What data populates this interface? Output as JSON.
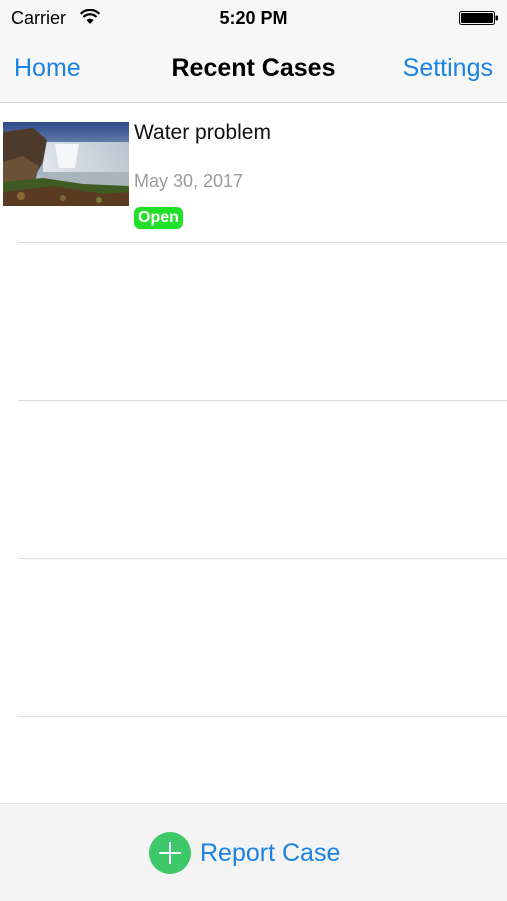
{
  "status_bar": {
    "carrier": "Carrier",
    "time": "5:20 PM",
    "icons": [
      "wifi-icon",
      "battery-icon"
    ]
  },
  "nav": {
    "left_label": "Home",
    "title": "Recent Cases",
    "right_label": "Settings"
  },
  "cases": [
    {
      "title": "Water problem",
      "date": "May 30, 2017",
      "status": "Open",
      "thumbnail": "waterfall-photo"
    }
  ],
  "toolbar": {
    "report_label": "Report Case",
    "report_icon": "plus-circle-icon"
  },
  "colors": {
    "accent": "#1a82e2",
    "status_open": "#22e02a",
    "report_icon": "#3ec86a"
  }
}
